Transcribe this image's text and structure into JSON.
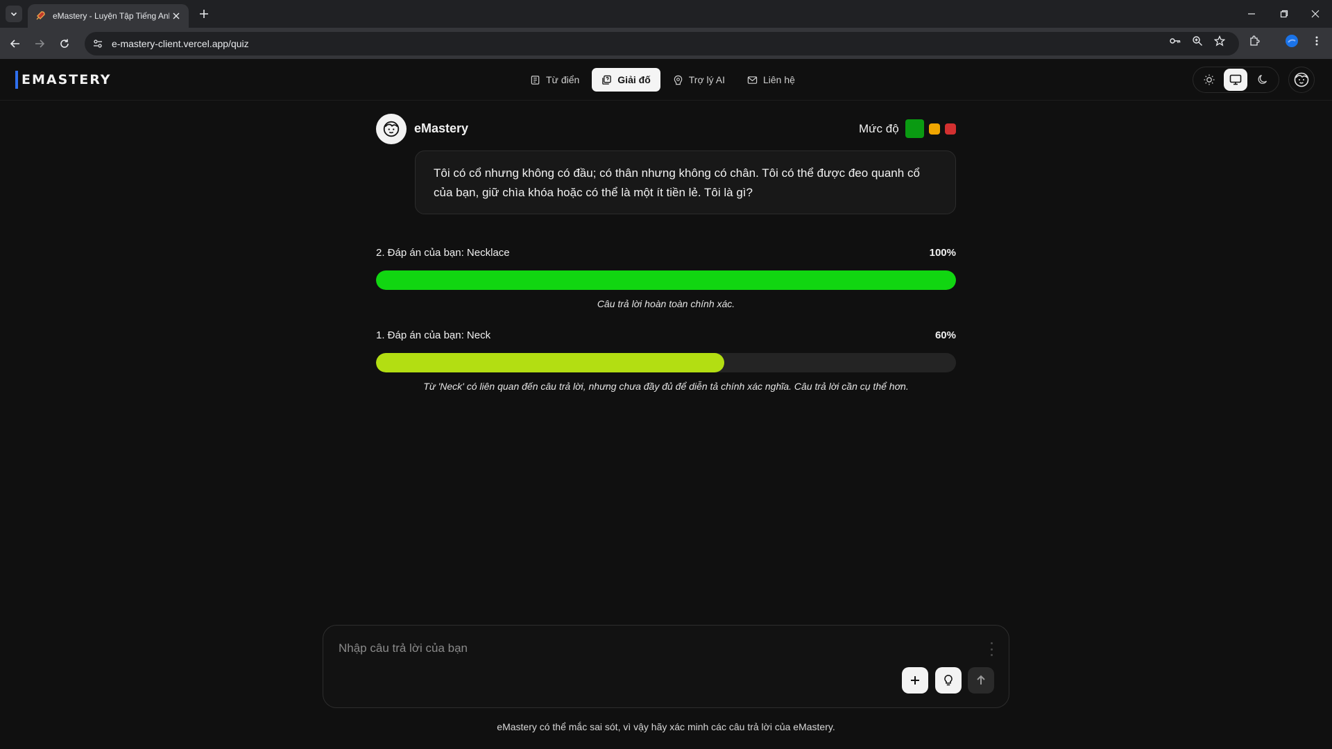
{
  "browser": {
    "tab_title": "eMastery - Luyện Tập Tiếng Anh",
    "url": "e-mastery-client.vercel.app/quiz"
  },
  "header": {
    "logo": "EMASTERY",
    "nav": [
      {
        "label": "Từ điển",
        "icon": "book-icon"
      },
      {
        "label": "Giải đố",
        "icon": "puzzle-icon",
        "active": true
      },
      {
        "label": "Trợ lý AI",
        "icon": "ai-assistant-icon"
      },
      {
        "label": "Liên hệ",
        "icon": "mail-icon"
      }
    ],
    "theme_options": [
      "light",
      "system",
      "dark"
    ],
    "theme_selected": "system"
  },
  "quiz": {
    "bot_name": "eMastery",
    "level_label": "Mức độ",
    "level_colors": {
      "easy": "#0a9a12",
      "medium": "#f0a500",
      "hard": "#d33030"
    },
    "level_selected": "easy",
    "question": "Tôi có cổ nhưng không có đầu; có thân nhưng không có chân. Tôi có thể được đeo quanh cổ của bạn, giữ chìa khóa hoặc có thể là một ít tiền lẻ. Tôi là gì?",
    "answers": [
      {
        "label": "2. Đáp án của bạn: Necklace",
        "percent_label": "100%",
        "score": 100,
        "color": "#11d611",
        "feedback": "Câu trả lời hoàn toàn chính xác."
      },
      {
        "label": "1. Đáp án của bạn: Neck",
        "percent_label": "60%",
        "score": 60,
        "color": "#b3de12",
        "feedback": "Từ 'Neck' có liên quan đến câu trả lời, nhưng chưa đầy đủ để diễn tả chính xác nghĩa. Câu trả lời cần cụ thể hơn."
      }
    ]
  },
  "input": {
    "placeholder": "Nhập câu trả lời của bạn",
    "value": ""
  },
  "disclaimer": "eMastery có thể mắc sai sót, vì vậy hãy xác minh các câu trả lời của eMastery."
}
